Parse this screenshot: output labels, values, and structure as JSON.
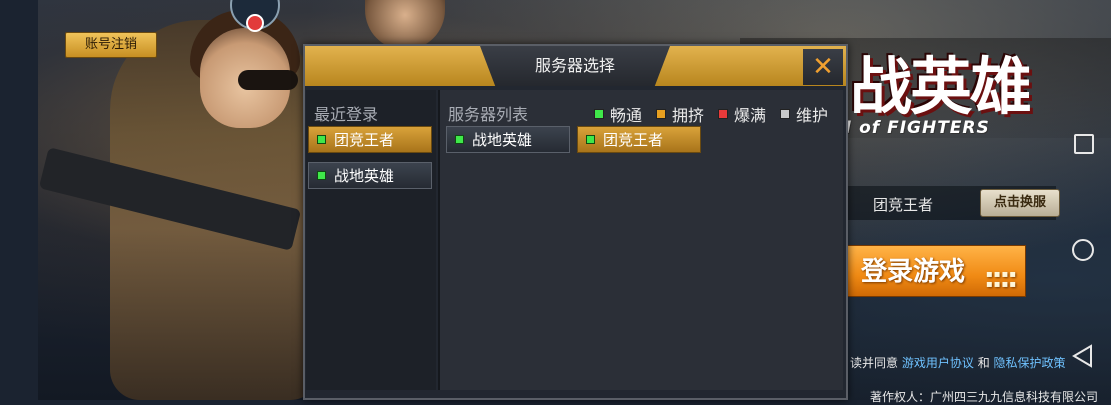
{
  "account": {
    "logout_label": "账号注销"
  },
  "logo": {
    "title": "战英雄",
    "subtitle": "GH of FIGHTERS"
  },
  "main": {
    "current_server": "团竞王者",
    "switch_label": "点击换服",
    "login_label": "登录游戏",
    "agree_prefix": "读并同意",
    "agree_link1": "游戏用户协议",
    "agree_and": "和",
    "agree_link2": "隐私保护政策",
    "copyright": "著作权人：广州四三九九信息科技有限公司"
  },
  "dialog": {
    "title": "服务器选择",
    "close_glyph": "✕",
    "recent_title": "最近登录",
    "list_title": "服务器列表",
    "legend": [
      {
        "label": "畅通",
        "color": "#3fe84a"
      },
      {
        "label": "拥挤",
        "color": "#e8a020"
      },
      {
        "label": "爆满",
        "color": "#e83a3a"
      },
      {
        "label": "维护",
        "color": "#c8c8c8"
      }
    ],
    "recent": [
      {
        "name": "团竞王者",
        "selected": true
      },
      {
        "name": "战地英雄",
        "selected": false
      }
    ],
    "servers": [
      {
        "name": "战地英雄",
        "selected": false
      },
      {
        "name": "团竞王者",
        "selected": true
      }
    ]
  },
  "colors": {
    "accent": "#d9a23a",
    "status_smooth": "#3fe84a",
    "link": "#6fc2ff"
  }
}
